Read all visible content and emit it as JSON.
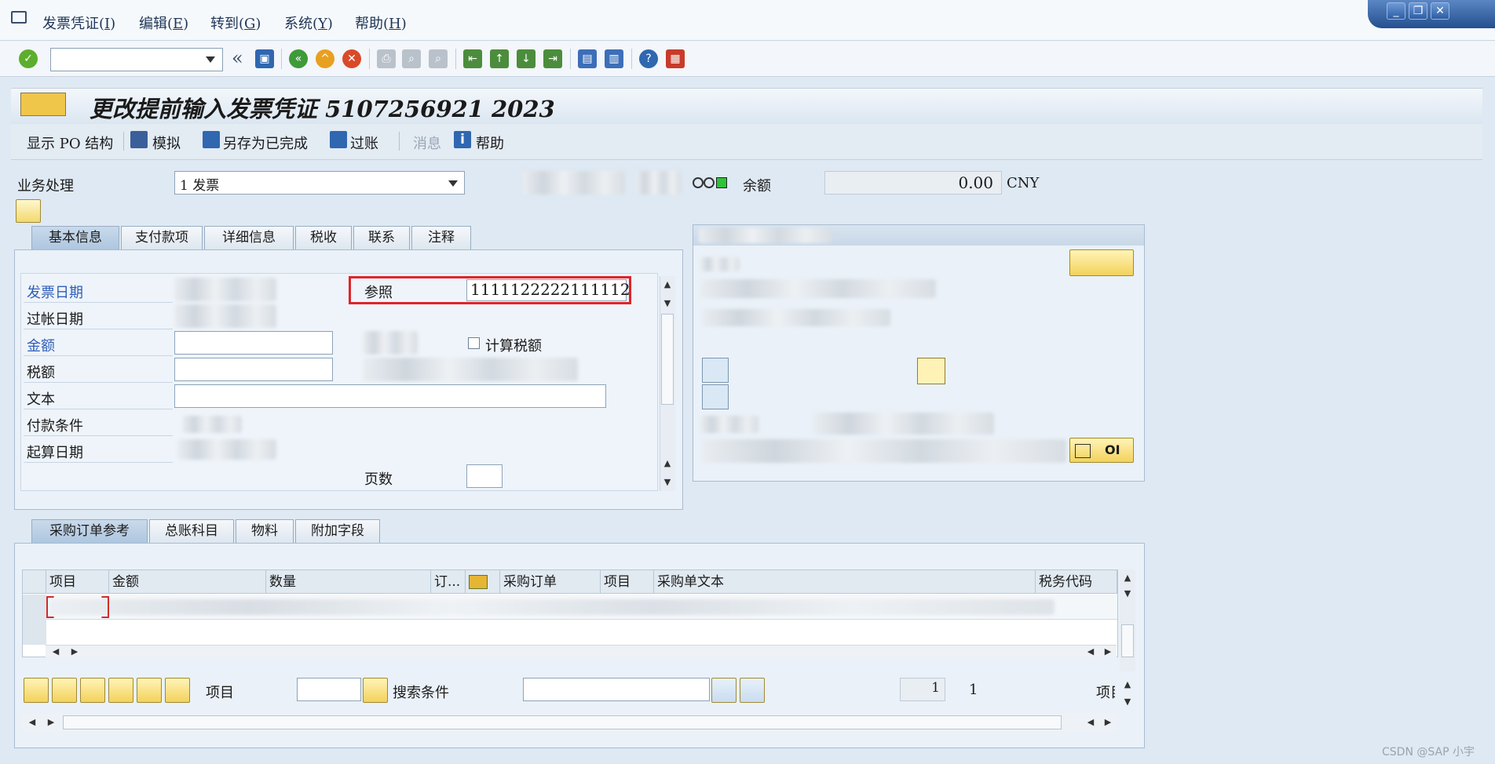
{
  "menu": {
    "items": [
      {
        "text": "发票凭证(",
        "key": "I",
        "end": ")"
      },
      {
        "text": "编辑(",
        "key": "E",
        "end": ")"
      },
      {
        "text": "转到(",
        "key": "G",
        "end": ")"
      },
      {
        "text": "系统(",
        "key": "Y",
        "end": ")"
      },
      {
        "text": "帮助(",
        "key": "H",
        "end": ")"
      }
    ]
  },
  "window": {
    "minimize": "_",
    "restore": "❐",
    "close": "✕"
  },
  "toolbar": {
    "command_value": "",
    "nav_back": "«"
  },
  "title": "更改提前输入发票凭证 5107256921 2023",
  "app_toolbar": {
    "show_po": "显示 PO 结构",
    "simulate": "模拟",
    "save_complete": "另存为已完成",
    "post": "过账",
    "messages": "消息",
    "help": "帮助"
  },
  "header": {
    "txn_label": "业务处理",
    "txn_value": "1 发票",
    "balance_label": "余额",
    "balance_value": "0.00",
    "currency": "CNY"
  },
  "tabs_top": [
    "基本信息",
    "支付款项",
    "详细信息",
    "税收",
    "联系",
    "注释"
  ],
  "basic": {
    "invoice_date": "发票日期",
    "posting_date": "过帐日期",
    "amount": "金额",
    "tax": "税额",
    "text": "文本",
    "payment_terms": "付款条件",
    "baseline_date": "起算日期",
    "reference_label": "参照",
    "reference_value": "1111122222111112",
    "calc_tax": "计算税额",
    "pages": "页数"
  },
  "vendor": {
    "oi_button": "OI"
  },
  "tabs_bottom": [
    "采购订单参考",
    "总账科目",
    "物料",
    "附加字段"
  ],
  "grid": {
    "columns": [
      "项目",
      "金额",
      "数量",
      "订...",
      "",
      "采购订单",
      "项目",
      "采购单文本",
      "税务代码"
    ]
  },
  "footer": {
    "item_label": "项目",
    "search_label": "搜索条件",
    "page_current": "1",
    "page_total": "1",
    "item_right": "项目"
  },
  "watermark": "CSDN @SAP 小宇"
}
